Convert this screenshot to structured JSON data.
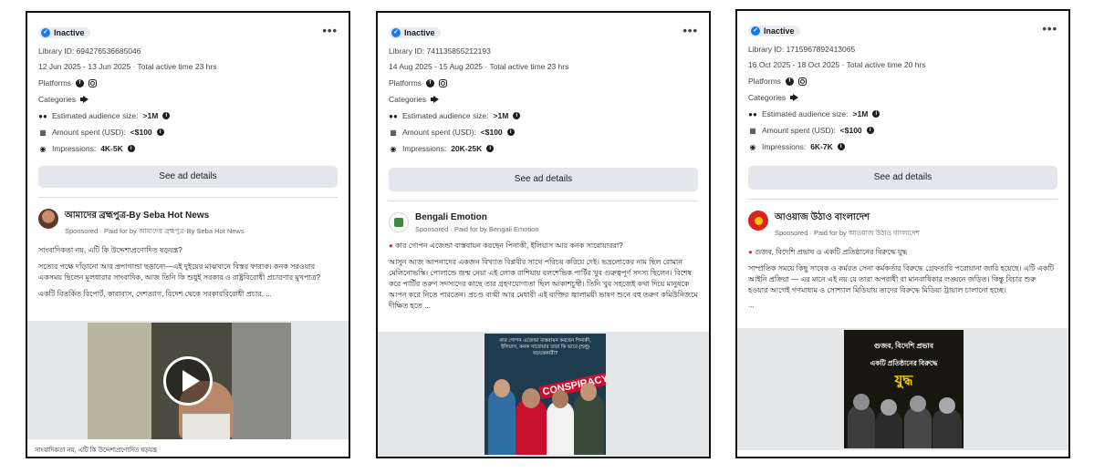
{
  "colors": {
    "accent": "#1877f2",
    "border": "#111111",
    "button_bg": "#e4e6eb",
    "poster1_bg": "#1e3b4f",
    "poster2_bg": "#17160f",
    "poster2_title": "#ffd200"
  },
  "cards": [
    {
      "status": "Inactive",
      "more": "•••",
      "library_id": "Library ID: 694276536685046",
      "dates": "12 Jun 2025 - 13 Jun 2025 · Total active time 23 hrs",
      "platforms_label": "Platforms",
      "categories_label": "Categories",
      "audience_label": "Estimated audience size:",
      "audience_value": ">1M",
      "amount_label": "Amount spent (USD):",
      "amount_value": "<$100",
      "impressions_label": "Impressions:",
      "impressions_value": "4K-5K",
      "button": "See ad details",
      "page_name": "আমাদের ব্রহ্মপুত্র-By Seba Hot News",
      "sponsored": "Sponsored · Paid for by আমাদের ব্রহ্মপুত্র-By Seba Hot News",
      "body": [
        "সাংবাদিকতা নয়, এটি কি উদ্দেশ্যপ্রণোদিত ষড়যন্ত্র?",
        "সত্যের পক্ষে দাঁড়ানো আর প্রপাগান্ডা ছড়ানো—এই দুইয়ের মাঝখানে বিস্তর ফারাক। কনক সরওয়ার একসময় ছিলেন মূলধারার সাংবাদিক, আজ তিনি কি শুধুই সরকার ও রাষ্ট্রবিরোধী প্রচারণার মুখপাত্র?",
        "একটি বিতর্কিত রিপোর্ট, কারাবাস, দেশত্যাগ, বিদেশ থেকে সরকারবিরোধী প্রচার, ..."
      ],
      "caption": "সাংবাদিকতা নয়, এটি কি উদ্দেশ্যপ্রণোদিত ষড়যন্ত্র"
    },
    {
      "status": "Inactive",
      "more": "•••",
      "library_id": "Library ID: 741135855212193",
      "dates": "14 Aug 2025 - 15 Aug 2025 · Total active time 23 hrs",
      "platforms_label": "Platforms",
      "categories_label": "Categories",
      "audience_label": "Estimated audience size:",
      "audience_value": ">1M",
      "amount_label": "Amount spent (USD):",
      "amount_value": "<$100",
      "impressions_label": "Impressions:",
      "impressions_value": "20K-25K",
      "button": "See ad details",
      "page_name": "Bengali Emotion",
      "sponsored": "Sponsored · Paid for by Bengali Emotion",
      "headline": "কার গোপন এজেন্ডা বাস্তবায়ন করছেন পিনাকী, ইলিয়াস আর কনক সারোয়াররা?",
      "body": [
        "আসুন আজ আপনাদের একজন বিখ্যাত বিপ্লবীর সাথে পরিচয় করিয়ে দেই। ভদ্রলোকের নাম ছিল রোমান মেলিনোভস্কি। পোলান্ডে জন্ম নেয়া এই লোক রাশিয়ায় বলশেভিক পার্টির খুব গুরুত্বপূর্ণ সদস্য ছিলেন। বিশেষ করে পার্টির তরুণ সদস্যদের কাছে তার গ্রহণযোগ্যতা ছিল আকাশচুম্বী। তিনি খুব সহজেই কথা দিয়ে মানুষকে আপন করে নিতে পারতেন। প্রচণ্ড বাগ্মী আর মেধাবী এই ব্যক্তির জ্বালাময়ী ভাষণ শুনে বহু তরুণ কমিউনিজমে দীক্ষিত হতে ..."
      ],
      "poster_top": "কার গোপন এজেন্ডা বাস্তবায়ন করছেন পিনাকী, ইলিয়াস, কনক সারোয়ার তারা কি ভাবে (শুধু) ষড়যন্ত্রকারী?",
      "poster_word": "CONSPIRACY"
    },
    {
      "status": "Inactive",
      "more": "•••",
      "library_id": "Library ID: 1715967892413065",
      "dates": "16 Oct 2025 - 18 Oct 2025 · Total active time 20 hrs",
      "platforms_label": "Platforms",
      "categories_label": "Categories",
      "audience_label": "Estimated audience size:",
      "audience_value": ">1M",
      "amount_label": "Amount spent (USD):",
      "amount_value": "<$100",
      "impressions_label": "Impressions:",
      "impressions_value": "6K-7K",
      "button": "See ad details",
      "page_name": "আওয়াজ উঠাও বাংলাদেশ",
      "sponsored": "Sponsored · Paid for by আওয়াজ উঠাও বাংলাদেশ",
      "headline": "গুজব, বিদেশি প্রভাব ও একটি প্রতিষ্ঠানের বিরুদ্ধে যুদ্ধ",
      "body": [
        "সাম্প্রতিক সময়ে কিছু সাবেক ও কর্মরত সেনা কর্মকর্তার বিরুদ্ধে গ্রেফতারি পরোয়ানা জারি হয়েছে। এটি একটি আইনি প্রক্রিয়া — এর মানে এই নয় যে তারা অপরাধী বা মানবাধিকার লঙ্ঘনে জড়িত। কিন্তু বিচার শুরু হওয়ার আগেই গণমাধ্যম ও সোশ্যাল মিডিয়ায় তাদের বিরুদ্ধে মিডিয়া ট্রায়াল চালানো হচ্ছে।",
        "..."
      ],
      "poster_line1": "গুজব, বিদেশি প্রভাব",
      "poster_line2": "একটি প্রতিষ্ঠানের বিরুদ্ধে",
      "poster_word": "যুদ্ধ"
    }
  ]
}
